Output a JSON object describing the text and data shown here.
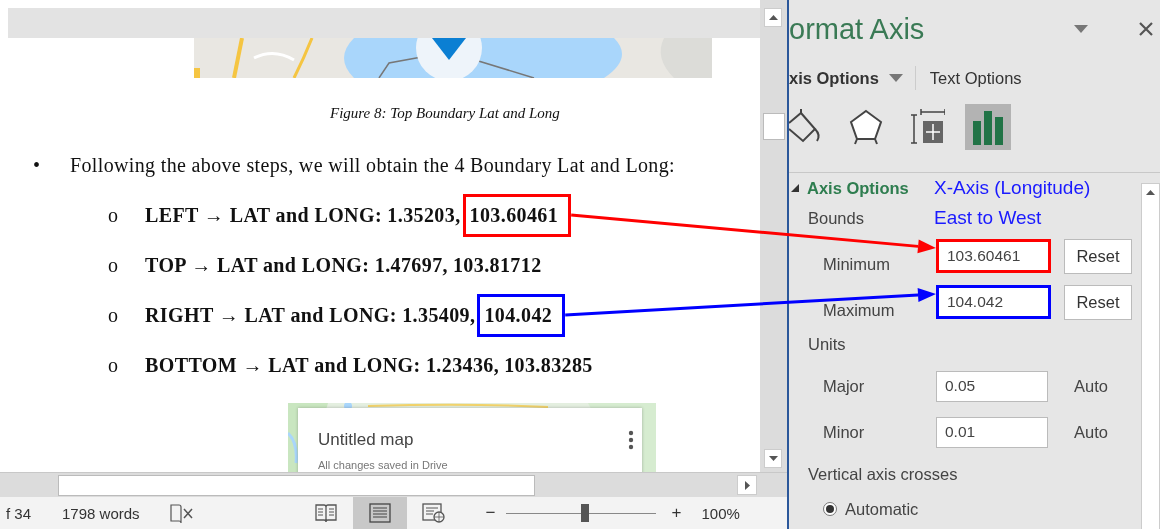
{
  "document": {
    "caption": "Figure 8: Top Boundary Lat and Long",
    "bullet": {
      "marker": "•",
      "text": "Following the above steps, we will obtain the 4 Boundary Lat and Long:"
    },
    "items": [
      {
        "marker": "o",
        "text": "LEFT → LAT and LONG: 1.35203,",
        "value": "103.60461",
        "color": "#ff0000"
      },
      {
        "marker": "o",
        "text": "TOP → LAT and LONG: 1.47697,",
        "value": "103.81712"
      },
      {
        "marker": "o",
        "text": "RIGHT → LAT and LONG: 1.35409,",
        "value": "104.042",
        "color": "#0000ff"
      },
      {
        "marker": "o",
        "text": "BOTTOM → LAT and LONG: 1.23436,",
        "value": "103.83285"
      }
    ],
    "map_card": {
      "title": "Untitled map",
      "subtitle": "All changes saved in Drive"
    }
  },
  "status_bar": {
    "page": "f 34",
    "words": "1798 words",
    "views": [
      {
        "kind": "read",
        "selected": false
      },
      {
        "kind": "print",
        "selected": true
      },
      {
        "kind": "web",
        "selected": false
      }
    ],
    "zoom": {
      "minus": "−",
      "plus": "+",
      "level": 0.53,
      "reading": "100%"
    }
  },
  "pane": {
    "title": "ormat Axis",
    "tabs": [
      {
        "label": "xis Options",
        "selected": true
      },
      {
        "label": "Text Options",
        "selected": false
      }
    ],
    "icon_tabs": [
      {
        "kind": "fill",
        "selected": false
      },
      {
        "kind": "effects",
        "selected": false
      },
      {
        "kind": "size",
        "selected": false
      },
      {
        "kind": "axis",
        "selected": true
      }
    ],
    "section": {
      "title": "Axis Options",
      "expanded": true
    },
    "note": [
      "X-Axis (Longitude)",
      "East to West"
    ],
    "bounds": {
      "label": "Bounds",
      "rows": [
        {
          "label": "Minimum",
          "value": "103.60461",
          "button": "Reset",
          "color": "#ff0000"
        },
        {
          "label": "Maximum",
          "value": "104.042",
          "button": "Reset",
          "color": "#0000ff"
        }
      ]
    },
    "units": {
      "label": "Units",
      "rows": [
        {
          "label": "Major",
          "value": "0.05",
          "status": "Auto"
        },
        {
          "label": "Minor",
          "value": "0.01",
          "status": "Auto"
        }
      ]
    },
    "crosses": {
      "label": "Vertical axis crosses",
      "options": [
        {
          "label": "Automatic",
          "selected": true
        }
      ]
    }
  }
}
